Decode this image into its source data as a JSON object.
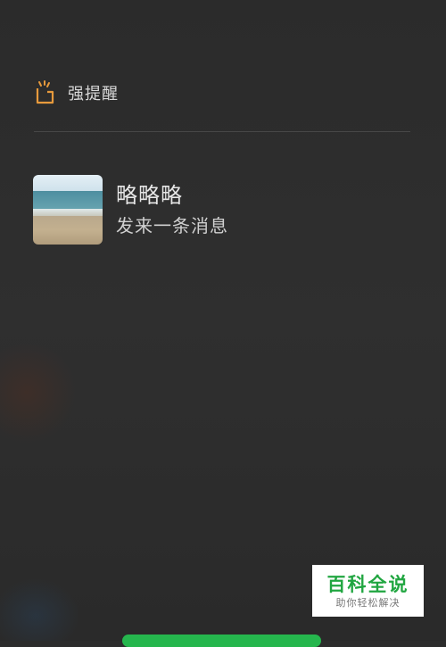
{
  "header": {
    "icon": "bell-icon",
    "title": "强提醒",
    "accent_color": "#e79a3c"
  },
  "message": {
    "avatar": "beach-avatar",
    "sender": "略略略",
    "preview": "发来一条消息"
  },
  "watermark": {
    "main": "百科全说",
    "sub": "助你轻松解决",
    "color": "#21a641"
  },
  "bottom_button": {
    "color": "#25b64d"
  }
}
